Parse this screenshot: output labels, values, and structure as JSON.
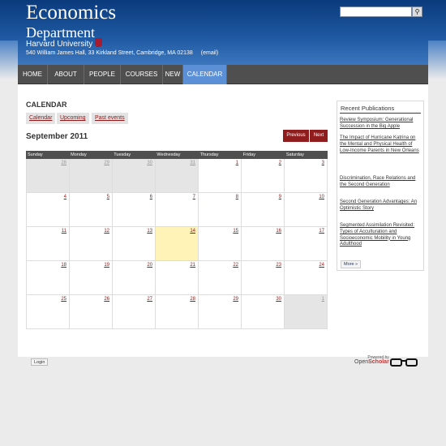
{
  "header": {
    "title": "Economics",
    "subtitle": "Department",
    "university": "Harvard University",
    "address": "540 William James Hall, 33 Kirkland Street, Cambridge, MA 02138",
    "email_link": "(email)",
    "search_placeholder": "",
    "search_button_icon": "search-icon"
  },
  "nav": {
    "items": [
      {
        "label": "HOME"
      },
      {
        "label": "ABOUT"
      },
      {
        "label": "PEOPLE"
      },
      {
        "label": "COURSES"
      },
      {
        "label": "NEW"
      },
      {
        "label": "CALENDAR"
      }
    ],
    "active": "CALENDAR"
  },
  "calendar": {
    "section_title": "CALENDAR",
    "tabs": [
      "Calendar",
      "Upcoming",
      "Past events"
    ],
    "month_title": "September 2011",
    "prev_label": "Previous",
    "next_label": "Next",
    "weekdays": [
      "Sunday",
      "Monday",
      "Tuesday",
      "Wednesday",
      "Thursday",
      "Friday",
      "Saturday"
    ],
    "weeks": [
      [
        "28",
        "29",
        "30",
        "31",
        "1",
        "2",
        "3"
      ],
      [
        "4",
        "5",
        "6",
        "7",
        "8",
        "9",
        "10"
      ],
      [
        "11",
        "12",
        "13",
        "14",
        "15",
        "16",
        "17"
      ],
      [
        "18",
        "19",
        "20",
        "21",
        "22",
        "23",
        "24"
      ],
      [
        "25",
        "26",
        "27",
        "28",
        "29",
        "30",
        "1"
      ]
    ],
    "today": "14"
  },
  "publications": {
    "title": "Recent Publications",
    "items": [
      "Review Symposium: Generational Succession in the Big Apple",
      "The Impact of Hurricane Katrina on the Mental and Physical Health of Low-Income Parents in New Orleans",
      "Discrimination, Race Relations and the Second Generation",
      "Second Generation Advantages: An Optimistic Story",
      "Segmented Assimilation Revisited: Types of Acculturation and Socioeconomic Mobility in Young Adulthood"
    ],
    "more_label": "More »"
  },
  "footer": {
    "login_label": "Login",
    "powered_by": "Powered by",
    "brand_open": "Open",
    "brand_scholar": "Scholar"
  },
  "colors": {
    "header_blue": "#1f5aa3",
    "nav_gray": "#4f4f4f",
    "nav_active": "#5b8fd6",
    "accent_red": "#8f1d1d",
    "today_yellow": "#fff3b8"
  }
}
